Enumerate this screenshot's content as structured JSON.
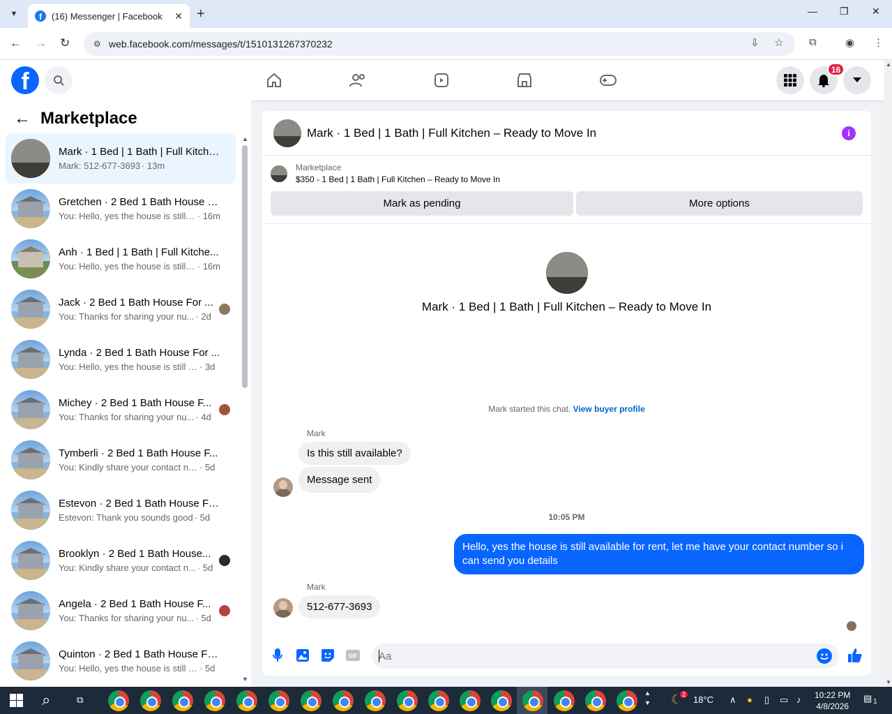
{
  "browser": {
    "tab_title": "(16) Messenger | Facebook",
    "url": "web.facebook.com/messages/t/1510131267370232"
  },
  "fb": {
    "notification_count": "16"
  },
  "left_panel": {
    "title": "Marketplace",
    "conversations": [
      {
        "name": "Mark · 1 Bed | 1 Bath | Full Kitche...",
        "preview": "Mark: 512-677-3693",
        "time": "· 13m",
        "active": true
      },
      {
        "name": "Gretchen · 2 Bed 1 Bath House F...",
        "preview": "You: Hello, yes the house is still a...",
        "time": "· 16m"
      },
      {
        "name": "Anh · 1 Bed | 1 Bath | Full Kitche...",
        "preview": "You: Hello, yes the house is still a...",
        "time": "· 16m"
      },
      {
        "name": "Jack · 2 Bed 1 Bath House For ...",
        "preview": "You: Thanks for sharing your nu...",
        "time": "· 2d"
      },
      {
        "name": "Lynda · 2 Bed 1 Bath House For ...",
        "preview": "You: Hello, yes the house is still ava...",
        "time": "· 3d"
      },
      {
        "name": "Michey · 2 Bed 1 Bath House F...",
        "preview": "You: Thanks for sharing your nu...",
        "time": "· 4d"
      },
      {
        "name": "Tymberli · 2 Bed 1 Bath House F...",
        "preview": "You: Kindly share your contact num...",
        "time": "· 5d"
      },
      {
        "name": "Estevon · 2 Bed 1 Bath House Fo...",
        "preview": "Estevon: Thank you sounds good",
        "time": "· 5d"
      },
      {
        "name": "Brooklyn · 2 Bed 1 Bath House...",
        "preview": "You: Kindly share your contact n...",
        "time": "· 5d"
      },
      {
        "name": "Angela · 2 Bed 1 Bath House F...",
        "preview": "You: Thanks for sharing your nu...",
        "time": "· 5d"
      },
      {
        "name": "Quinton · 2 Bed 1 Bath House Fo...",
        "preview": "You: Hello, yes the house is still ava...",
        "time": "· 5d"
      }
    ]
  },
  "chat": {
    "header_name": "Mark · 1 Bed | 1 Bath | Full Kitchen – Ready to Move In",
    "marketplace_label": "Marketplace",
    "listing": "$350 - 1 Bed | 1 Bath | Full Kitchen – Ready to Move In",
    "mark_pending": "Mark as pending",
    "more_options": "More options",
    "center_name": "Mark · 1 Bed | 1 Bath | Full Kitchen – Ready to Move In",
    "started_text": "Mark started this chat.",
    "buyer_profile_link": "View buyer profile",
    "sender1": "Mark",
    "msg1": "Is this still available?",
    "msg2": "Message sent",
    "timestamp": "10:05 PM",
    "my_msg": "Hello, yes the house is still available for rent, let me have your contact number so i can send you  details",
    "sender2": "Mark",
    "msg3": "512-677-3693",
    "composer_placeholder": "Aa"
  },
  "taskbar": {
    "temperature": "18°C",
    "weather_badge": "2",
    "time": "10:22 PM",
    "date": "4/8/2026",
    "notif_count": "1"
  }
}
